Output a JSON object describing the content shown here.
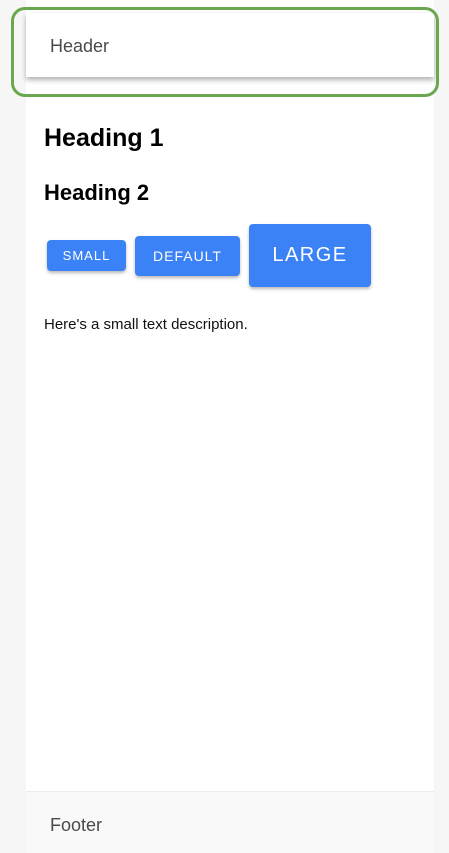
{
  "header": {
    "title": "Header"
  },
  "main": {
    "heading1": "Heading 1",
    "heading2": "Heading 2",
    "buttons": {
      "small": "SMALL",
      "default": "DEFAULT",
      "large": "LARGE"
    },
    "description": "Here's a small text description."
  },
  "footer": {
    "title": "Footer"
  },
  "colors": {
    "primary_button": "#3b82f6",
    "highlight_ring": "#6aa84f"
  }
}
